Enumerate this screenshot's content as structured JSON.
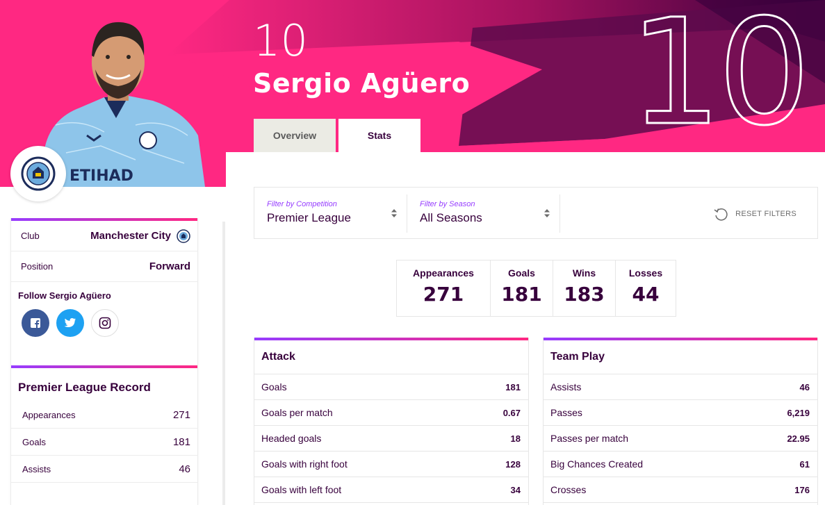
{
  "hero": {
    "shirt_number": "10",
    "big_number": "10",
    "player_name": "Sergio Agüero"
  },
  "tabs": [
    {
      "label": "Overview",
      "active": false
    },
    {
      "label": "Stats",
      "active": true
    }
  ],
  "sidebar": {
    "club_label": "Club",
    "club_value": "Manchester City",
    "position_label": "Position",
    "position_value": "Forward",
    "follow_title": "Follow Sergio Agüero",
    "socials": [
      "facebook-icon",
      "twitter-icon",
      "instagram-icon"
    ],
    "record_title": "Premier League Record",
    "record": [
      {
        "label": "Appearances",
        "value": "271"
      },
      {
        "label": "Goals",
        "value": "181"
      },
      {
        "label": "Assists",
        "value": "46"
      }
    ]
  },
  "filters": {
    "competition_label": "Filter by Competition",
    "competition_value": "Premier League",
    "season_label": "Filter by Season",
    "season_value": "All Seasons",
    "reset_label": "RESET FILTERS"
  },
  "headline_stats": [
    {
      "label": "Appearances",
      "value": "271"
    },
    {
      "label": "Goals",
      "value": "181"
    },
    {
      "label": "Wins",
      "value": "183"
    },
    {
      "label": "Losses",
      "value": "44"
    }
  ],
  "attack": {
    "title": "Attack",
    "rows": [
      {
        "label": "Goals",
        "value": "181"
      },
      {
        "label": "Goals per match",
        "value": "0.67"
      },
      {
        "label": "Headed goals",
        "value": "18"
      },
      {
        "label": "Goals with right foot",
        "value": "128"
      },
      {
        "label": "Goals with left foot",
        "value": "34"
      }
    ]
  },
  "team_play": {
    "title": "Team Play",
    "rows": [
      {
        "label": "Assists",
        "value": "46"
      },
      {
        "label": "Passes",
        "value": "6,219"
      },
      {
        "label": "Passes per match",
        "value": "22.95"
      },
      {
        "label": "Big Chances Created",
        "value": "61"
      },
      {
        "label": "Crosses",
        "value": "176"
      }
    ]
  },
  "colors": {
    "primary": "#37003c",
    "pink": "#ff2882",
    "purple": "#963cff",
    "facebook": "#3b5998",
    "twitter": "#1da1f2"
  }
}
